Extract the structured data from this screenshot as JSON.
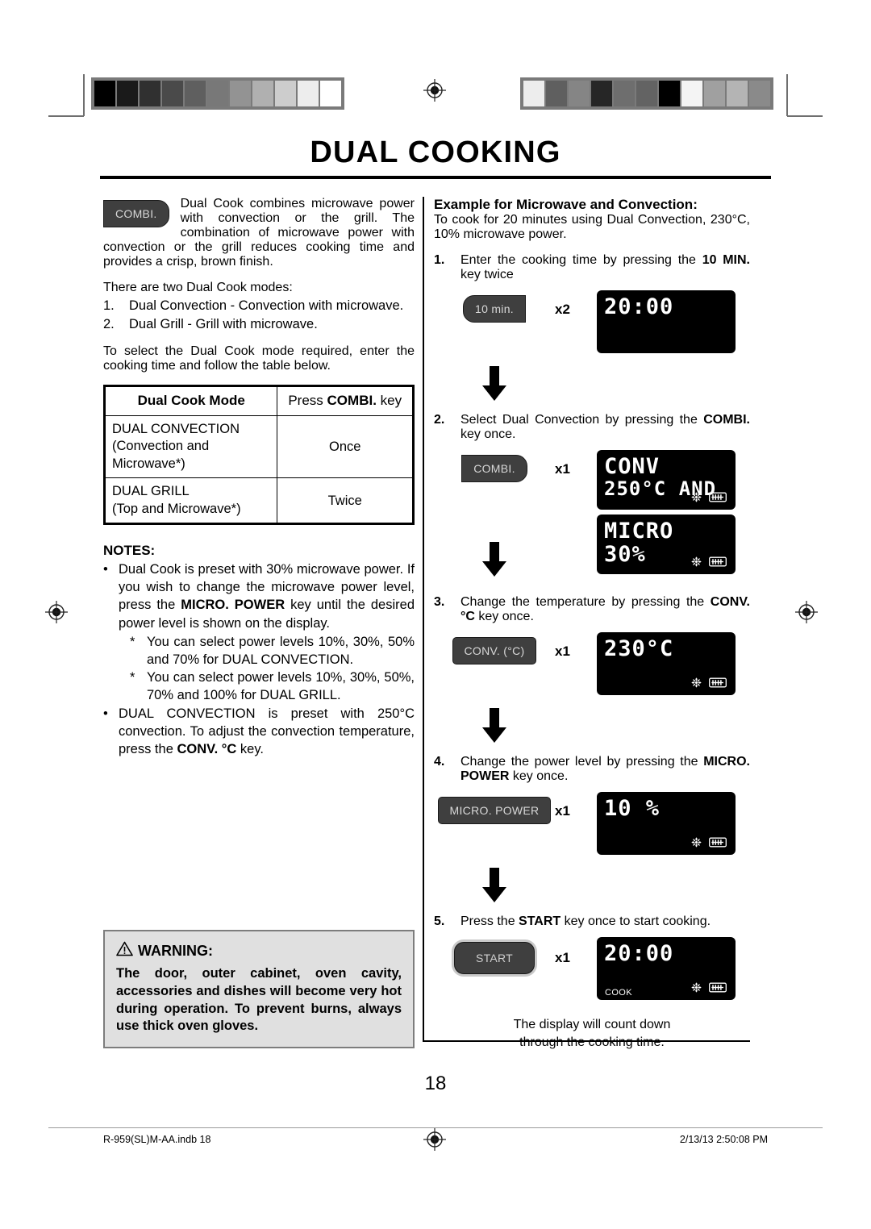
{
  "page": {
    "title": "DUAL COOKING",
    "page_number": "18",
    "footer_left": "R-959(SL)M-AA.indb   18",
    "footer_right": "2/13/13   2:50:08 PM"
  },
  "calibration": {
    "left_bar_colors": [
      "#000000",
      "#1a1a1a",
      "#303030",
      "#4a4a4a",
      "#5f5f5f",
      "#787878",
      "#939393",
      "#b0b0b0",
      "#cdcdcd",
      "#ededed",
      "#ffffff"
    ],
    "right_bar_colors": [
      "#ededed",
      "#5f5f5f",
      "#858585",
      "#262626",
      "#6e6e6e",
      "#636363",
      "#000000",
      "#f4f4f4",
      "#a0a0a0",
      "#b4b4b4",
      "#8a8a8a"
    ]
  },
  "left_column": {
    "intro_key_label": "COMBI.",
    "intro_paragraph": "Dual Cook combines microwave power with convection or the grill. The combination of microwave power with convection or the grill reduces cooking time and provides a crisp, brown finish.",
    "modes_lead": "There are two Dual Cook modes:",
    "modes_list": [
      {
        "n": "1.",
        "text": "Dual Convection - Convection with microwave."
      },
      {
        "n": "2.",
        "text": "Dual Grill - Grill with microwave."
      }
    ],
    "select_paragraph": "To select the Dual Cook mode required, enter the cooking time and follow the table below.",
    "table": {
      "headers": [
        "Dual Cook Mode",
        "Press COMBI. key"
      ],
      "header_2_normal": "Press ",
      "header_2_bold": "COMBI.",
      "header_2_tail": " key",
      "rows": [
        {
          "mode_line1": "DUAL CONVECTION",
          "mode_line2": "(Convection and",
          "mode_line3": "Microwave*)",
          "press": "Once"
        },
        {
          "mode_line1": "DUAL GRILL",
          "mode_line2": "(Top and Microwave*)",
          "mode_line3": "",
          "press": "Twice"
        }
      ]
    },
    "notes_heading": "NOTES:",
    "notes": [
      {
        "bullet": "•",
        "pre": "Dual Cook is preset with 30% microwave power. If you wish to change the microwave power level, press the ",
        "bold": "MICRO. POWER",
        "post": " key until the desired power level is shown on the display.",
        "sub": [
          {
            "ast": "*",
            "text": "You can select power levels 10%, 30%, 50% and 70% for DUAL CONVECTION."
          },
          {
            "ast": "*",
            "text": "You can select power levels 10%, 30%, 50%, 70% and 100% for DUAL GRILL."
          }
        ]
      },
      {
        "bullet": "•",
        "pre": "DUAL CONVECTION is preset with 250°C convection. To adjust the convection temperature, press the ",
        "bold": "CONV. °C",
        "post": " key.",
        "sub": []
      }
    ],
    "warning": {
      "heading": "WARNING:",
      "icon": "warning-triangle-icon",
      "body": "The door, outer cabinet, oven cavity, accessories and dishes will become very hot during operation. To prevent burns, always use thick oven gloves."
    }
  },
  "right_column": {
    "example_heading": "Example for Microwave and Convection:",
    "example_intro": "To cook for 20 minutes using Dual Convection, 230°C, 10% microwave power.",
    "steps": [
      {
        "n": "1.",
        "pre": "Enter the cooking time by pressing the ",
        "bold": "10 MIN.",
        "post": " key twice",
        "button_label": "10 min.",
        "button_shape": "rounded-left",
        "press_count": "x2",
        "displays": [
          {
            "lines": [
              "20:00"
            ],
            "icons": [],
            "status": ""
          }
        ]
      },
      {
        "n": "2.",
        "pre": "Select Dual Convection by pressing the ",
        "bold": "COMBI.",
        "post": " key once.",
        "button_label": "COMBI.",
        "button_shape": "rounded-right",
        "press_count": "x1",
        "displays": [
          {
            "lines": [
              "CONV",
              "250°C AND"
            ],
            "icons": [
              "fan-icon",
              "grill-icon"
            ],
            "status": ""
          },
          {
            "lines": [
              "MICRO",
              "30%"
            ],
            "icons": [
              "fan-icon",
              "grill-icon"
            ],
            "status": ""
          }
        ]
      },
      {
        "n": "3.",
        "pre": "Change the temperature by pressing the ",
        "bold": "CONV. °C",
        "post": " key once.",
        "button_label": "CONV. (°C)",
        "button_shape": "rect",
        "press_count": "x1",
        "displays": [
          {
            "lines": [
              "230°C"
            ],
            "icons": [
              "fan-icon",
              "grill-icon"
            ],
            "status": ""
          }
        ]
      },
      {
        "n": "4.",
        "pre": "Change the power level by pressing the ",
        "bold": "MICRO. POWER",
        "post": " key once.",
        "button_label": "MICRO. POWER",
        "button_shape": "rect",
        "press_count": "x1",
        "displays": [
          {
            "lines": [
              "10 %"
            ],
            "icons": [
              "fan-icon",
              "grill-icon"
            ],
            "status": ""
          }
        ]
      },
      {
        "n": "5.",
        "pre": "Press the ",
        "bold": "START",
        "post": " key once to start cooking.",
        "button_label": "START",
        "button_shape": "pill",
        "press_count": "x1",
        "displays": [
          {
            "lines": [
              "20:00"
            ],
            "icons": [
              "fan-icon",
              "grill-icon"
            ],
            "status": "COOK"
          }
        ]
      }
    ],
    "closing_line1": "The display will count down",
    "closing_line2": "through the cooking time."
  }
}
